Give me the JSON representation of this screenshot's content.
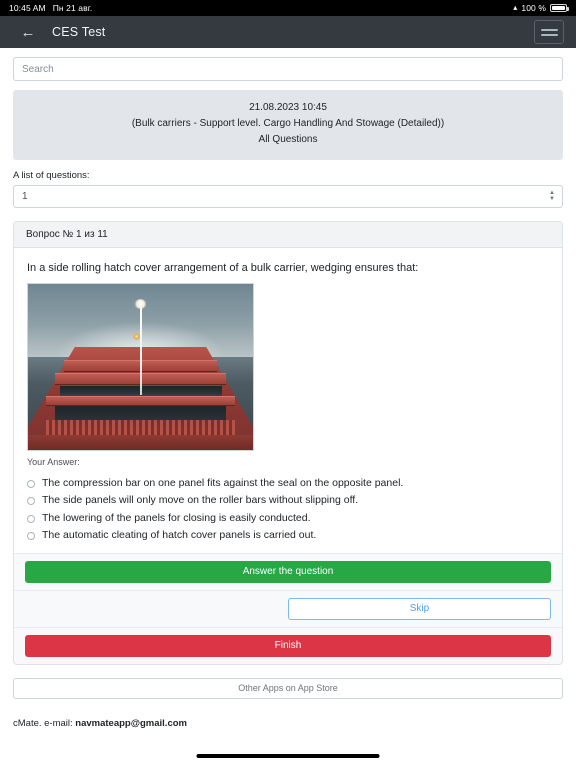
{
  "status_bar": {
    "time": "10:45 AM",
    "date": "Пн 21 авг.",
    "wifi_icon": "wifi-icon",
    "battery_percent": "100 %",
    "battery_icon": "battery-full-icon"
  },
  "navbar": {
    "back_icon": "back-arrow-icon",
    "title": "CES Test",
    "menu_icon": "hamburger-menu-icon"
  },
  "search": {
    "value": "",
    "placeholder": "Search"
  },
  "info_panel": {
    "datetime": "21.08.2023 10:45",
    "subject": "(Bulk carriers - Support level. Cargo Handling And Stowage (Detailed))",
    "scope": "All Questions"
  },
  "question_list": {
    "label": "A list of questions:",
    "selected": "1",
    "options": [
      "1"
    ]
  },
  "card": {
    "header": "Вопрос № 1 из 11",
    "question": "In a side rolling hatch cover arrangement of a bulk carrier, wedging ensures that:",
    "image_alt": "bulk-carrier-hatch-covers-photo",
    "answer_label": "Your Answer:",
    "options": [
      {
        "label": "The compression bar on one panel fits against the seal on the opposite panel.",
        "selected": false
      },
      {
        "label": "The side panels will only move on the roller bars without slipping off.",
        "selected": false
      },
      {
        "label": "The lowering of the panels for closing is easily conducted.",
        "selected": false
      },
      {
        "label": "The automatic cleating of hatch cover panels is carried out.",
        "selected": false
      }
    ],
    "buttons": {
      "answer": "Answer the question",
      "skip": "Skip",
      "finish": "Finish"
    }
  },
  "footer": {
    "store_button": "Other Apps on App Store",
    "credit_prefix": "cMate. e-mail: ",
    "email": "navmateapp@gmail.com"
  },
  "colors": {
    "navbar": "#343a40",
    "success": "#28a745",
    "danger": "#dc3545",
    "link": "#4aa3f0",
    "info_panel": "#e2e6ea"
  }
}
